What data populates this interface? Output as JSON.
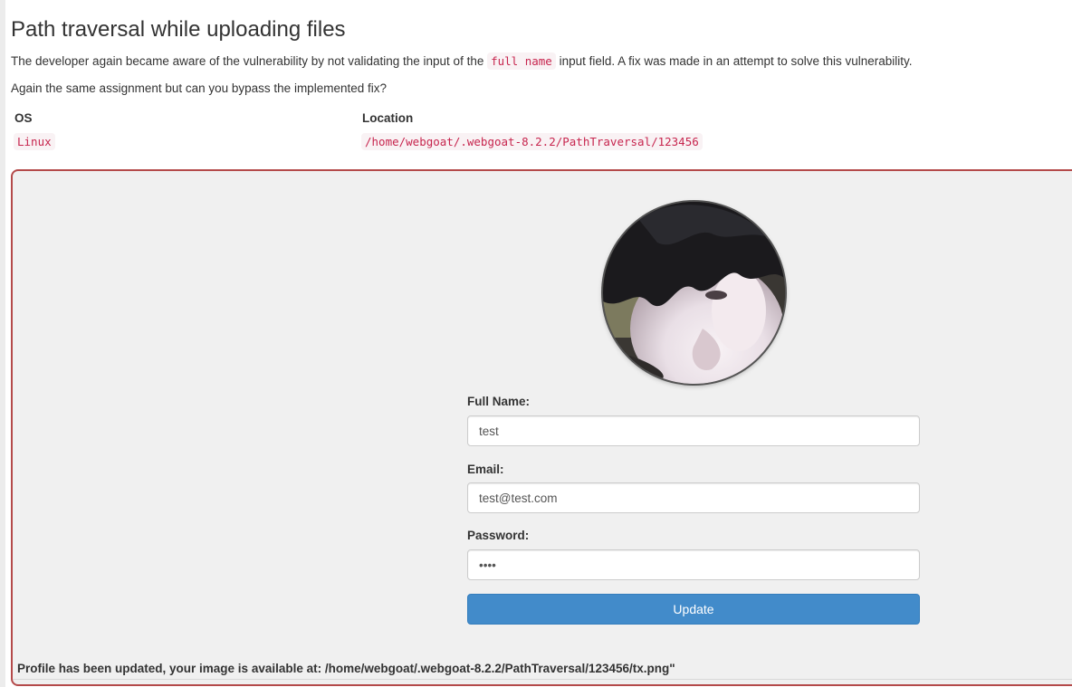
{
  "assignment": {
    "title": "Path traversal while uploading files",
    "intro_before": "The developer again became aware of the vulnerability by not validating the input of the ",
    "intro_code": "full name",
    "intro_after": " input field. A fix was made in an attempt to solve this vulnerability.",
    "question": "Again the same assignment but can you bypass the implemented fix?"
  },
  "info_table": {
    "headers": [
      "OS",
      "Location"
    ],
    "os": "Linux",
    "location": "/home/webgoat/.webgoat-8.2.2/PathTraversal/123456"
  },
  "form": {
    "full_name_label": "Full Name:",
    "full_name_value": "test",
    "email_label": "Email:",
    "email_value": "test@test.com",
    "password_label": "Password:",
    "password_value": "test",
    "update_button": "Update"
  },
  "feedback": "Profile has been updated, your image is available at: /home/webgoat/.webgoat-8.2.2/PathTraversal/123456/tx.png\"",
  "colors": {
    "panel_border": "#b44a4a",
    "panel_bg": "#f0f0f0",
    "button": "#428bca",
    "code_text": "#c7254e"
  }
}
